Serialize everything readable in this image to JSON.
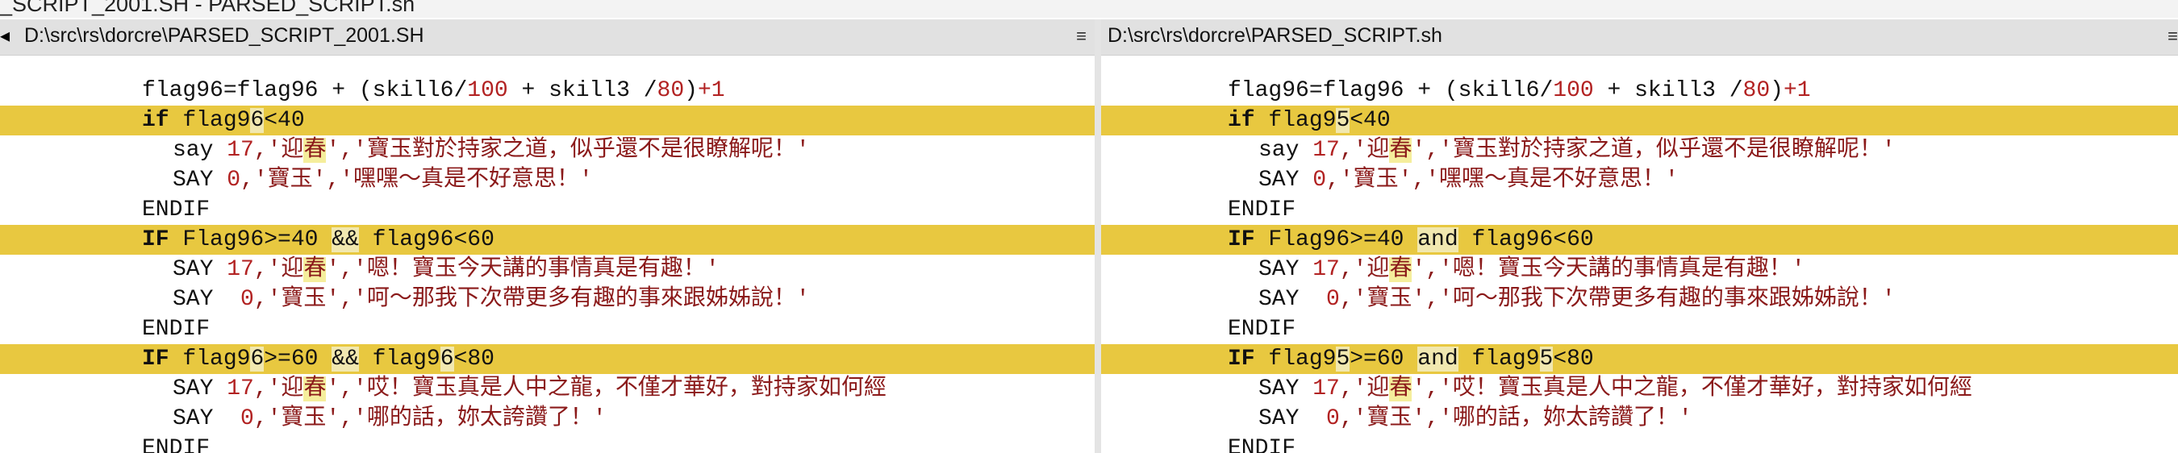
{
  "window": {
    "title": "_SCRIPT_2001.SH - PARSED_SCRIPT.sh"
  },
  "left_pane": {
    "path": "D:\\src\\rs\\dorcre\\PARSED_SCRIPT_2001.SH",
    "collapse": "◂",
    "menu": "≡",
    "lines": {
      "l1a": "flag96=flag96 + (skill6/",
      "l1n1": "100",
      "l1b": " + skill3 /",
      "l1n2": "80",
      "l1c": ")",
      "l1n3": "+1",
      "l2kw": "if",
      "l2a": " flag9",
      "l2b": "6",
      "l2c": "<40",
      "l3a": "say ",
      "l3n": "17",
      "l3b": ",'迎",
      "l3c": "春",
      "l3d": "','寶玉對於持家之道，似乎還不是很瞭解呢！'",
      "l4a": "SAY ",
      "l4n": "0",
      "l4b": ",'寶玉','嘿嘿～真是不好意思！'",
      "l5": "ENDIF",
      "l6kw": "IF",
      "l6a": " Flag96>=40 ",
      "l6op": "&&",
      "l6b": " flag96<60",
      "l7a": "SAY ",
      "l7n": "17",
      "l7b": ",'迎",
      "l7c": "春",
      "l7d": "','嗯！寶玉今天講的事情真是有趣！'",
      "l8a": "SAY  ",
      "l8n": "0",
      "l8b": ",'寶玉','呵～那我下次帶更多有趣的事來跟姊姊說！'",
      "l9": "ENDIF",
      "l10kw": "IF",
      "l10a": " flag9",
      "l10b": "6",
      "l10c": ">=60 ",
      "l10op": "&&",
      "l10d": " flag9",
      "l10e": "6",
      "l10f": "<80",
      "l11a": "SAY ",
      "l11n": "17",
      "l11b": ",'迎",
      "l11c": "春",
      "l11d": "','哎！寶玉真是人中之龍，不僅才華好，對持家如何經",
      "l12a": "SAY  ",
      "l12n": "0",
      "l12b": ",'寶玉','哪的話，妳太誇讚了！'",
      "l13": "ENDIF"
    }
  },
  "right_pane": {
    "path": "D:\\src\\rs\\dorcre\\PARSED_SCRIPT.sh",
    "menu": "≡",
    "lines": {
      "l1a": "flag96=flag96 + (skill6/",
      "l1n1": "100",
      "l1b": " + skill3 /",
      "l1n2": "80",
      "l1c": ")",
      "l1n3": "+1",
      "l2kw": "if",
      "l2a": " flag9",
      "l2b": "5",
      "l2c": "<40",
      "l3a": "say ",
      "l3n": "17",
      "l3b": ",'迎",
      "l3c": "春",
      "l3d": "','寶玉對於持家之道，似乎還不是很瞭解呢！'",
      "l4a": "SAY ",
      "l4n": "0",
      "l4b": ",'寶玉','嘿嘿～真是不好意思！'",
      "l5": "ENDIF",
      "l6kw": "IF",
      "l6a": " Flag96>=40 ",
      "l6op": "and",
      "l6b": " flag96<60",
      "l7a": "SAY ",
      "l7n": "17",
      "l7b": ",'迎",
      "l7c": "春",
      "l7d": "','嗯！寶玉今天講的事情真是有趣！'",
      "l8a": "SAY  ",
      "l8n": "0",
      "l8b": ",'寶玉','呵～那我下次帶更多有趣的事來跟姊姊說！'",
      "l9": "ENDIF",
      "l10kw": "IF",
      "l10a": " flag9",
      "l10b": "5",
      "l10c": ">=60 ",
      "l10op": "and",
      "l10d": " flag9",
      "l10e": "5",
      "l10f": "<80",
      "l11a": "SAY ",
      "l11n": "17",
      "l11b": ",'迎",
      "l11c": "春",
      "l11d": "','哎！寶玉真是人中之龍，不僅才華好，對持家如何經",
      "l12a": "SAY  ",
      "l12n": "0",
      "l12b": ",'寶玉','哪的話，妳太誇讚了！'",
      "l13": "ENDIF"
    }
  },
  "colors": {
    "diff_line": "#e8c840",
    "char_highlight": "#f5ee9c",
    "number": "#b22222",
    "header": "#e1e1e1"
  }
}
